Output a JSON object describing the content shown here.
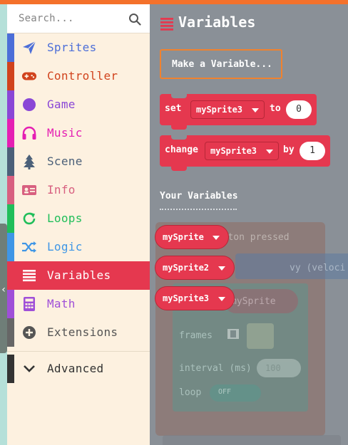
{
  "search": {
    "placeholder": "Search..."
  },
  "toolbox": {
    "categories": [
      {
        "label": "Sprites",
        "icon": "paper-plane-icon",
        "color": "#4c6ed8"
      },
      {
        "label": "Controller",
        "icon": "gamepad-icon",
        "color": "#d1431d"
      },
      {
        "label": "Game",
        "icon": "circle-icon",
        "color": "#8a47d6"
      },
      {
        "label": "Music",
        "icon": "headphones-icon",
        "color": "#e51fb3"
      },
      {
        "label": "Scene",
        "icon": "tree-icon",
        "color": "#4b6079"
      },
      {
        "label": "Info",
        "icon": "id-card-icon",
        "color": "#d86080"
      },
      {
        "label": "Loops",
        "icon": "refresh-icon",
        "color": "#20be5a"
      },
      {
        "label": "Logic",
        "icon": "shuffle-icon",
        "color": "#3f96e6"
      },
      {
        "label": "Variables",
        "icon": "list-icon",
        "color": "#e5384f",
        "active": true
      },
      {
        "label": "Math",
        "icon": "calculator-icon",
        "color": "#9f4fd8"
      },
      {
        "label": "Extensions",
        "icon": "plus-circle-icon",
        "color": "#666666"
      }
    ],
    "advanced": {
      "label": "Advanced",
      "icon": "chevron-down-icon",
      "color": "#333333"
    }
  },
  "flyout": {
    "title": "Variables",
    "make_variable_label": "Make a Variable...",
    "set_block": {
      "keyword": "set",
      "variable": "mySprite3",
      "to": "to",
      "value": "0"
    },
    "change_block": {
      "keyword": "change",
      "variable": "mySprite3",
      "by": "by",
      "value": "1"
    },
    "your_variables_heading": "Your Variables",
    "variables": [
      "mySprite",
      "mySprite2",
      "mySprite3"
    ]
  },
  "workspace_ghost": {
    "event_text": "button  pressed",
    "vy_text": "vy (veloci",
    "animate_text": "mySprite",
    "frames_label": "frames",
    "interval_label": "interval (ms)",
    "interval_value": "100",
    "loop_label": "loop",
    "loop_value": "OFF"
  },
  "colors": {
    "accent": "#e5384f",
    "topbar": "#f4712b",
    "make_var_border": "#f0822f",
    "workspace": "#8a9097",
    "toolbox_bg": "#fdf1e0"
  }
}
